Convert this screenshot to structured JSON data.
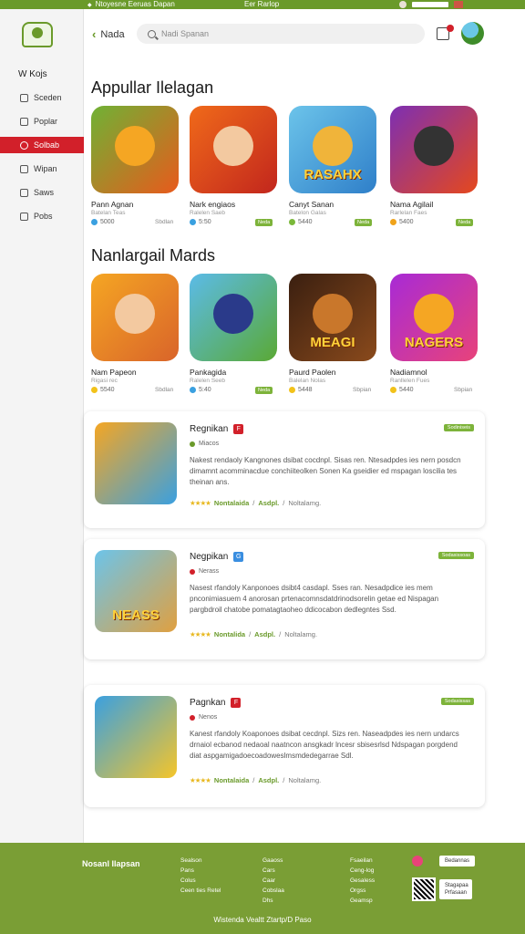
{
  "topbar": {
    "left": "Ntoyesne Eeruas Dapan",
    "center": "Eer Rarlop"
  },
  "sidebar": {
    "heading": "W Kojs",
    "items": [
      {
        "label": "Sceden",
        "active": false
      },
      {
        "label": "Poplar",
        "active": false
      },
      {
        "label": "Solbab",
        "active": true
      },
      {
        "label": "Wipan",
        "active": false
      },
      {
        "label": "Saws",
        "active": false
      },
      {
        "label": "Pobs",
        "active": false
      }
    ]
  },
  "header": {
    "back_label": "Nada",
    "search_placeholder": "Nadi Spanan"
  },
  "section1": {
    "title": "Appullar Ilelagan",
    "apps": [
      {
        "name": "Pann Agnan",
        "sub": "Batelan Teas",
        "rating": "5000",
        "dl": "Sbdlan",
        "tag": "",
        "img_text": "",
        "colors": [
          "#6fb235",
          "#e85a1c"
        ],
        "face": "#f5a623",
        "dot": "#3aa0e0"
      },
      {
        "name": "Nark engiaos",
        "sub": "Ralelen Saeb",
        "rating": "5:50",
        "dl": "",
        "tag": "Neda",
        "img_text": "",
        "colors": [
          "#f06a1a",
          "#c2261d"
        ],
        "face": "#f3c9a0",
        "dot": "#3aa0e0"
      },
      {
        "name": "Canyt Sanan",
        "sub": "Batelon Galas",
        "rating": "5440",
        "dl": "",
        "tag": "Neda",
        "img_text": "RASAHX",
        "colors": [
          "#6cc4ea",
          "#2f7fc9"
        ],
        "face": "#f0b43a",
        "dot": "#7ab83a"
      },
      {
        "name": "Nama Agilail",
        "sub": "Rarlelan Faes",
        "rating": "5400",
        "dl": "",
        "tag": "Neda",
        "img_text": "",
        "colors": [
          "#7d2fb3",
          "#e5481d"
        ],
        "face": "#333",
        "dot": "#f0a31a"
      }
    ]
  },
  "section2": {
    "title": "Nanlargail Mards",
    "apps": [
      {
        "name": "Nam Papeon",
        "sub": "Rigasi rec",
        "rating": "5540",
        "dl": "Sbdlan",
        "tag": "",
        "img_text": "",
        "colors": [
          "#f5a623",
          "#d9642a"
        ],
        "face": "#f3c9a0",
        "dot": "#f2c21a"
      },
      {
        "name": "Pankagida",
        "sub": "Ralelen Seeb",
        "rating": "5:40",
        "dl": "",
        "tag": "Neda",
        "img_text": "",
        "colors": [
          "#5bbbe8",
          "#5aa935"
        ],
        "face": "#2a3a8a",
        "dot": "#3aa0e0"
      },
      {
        "name": "Paurd Paolen",
        "sub": "Balelan Nolas",
        "rating": "5448",
        "dl": "Sbpian",
        "tag": "",
        "img_text": "MEAGI",
        "colors": [
          "#3a1f10",
          "#8a4a1c"
        ],
        "face": "#c9772b",
        "dot": "#f2c21a"
      },
      {
        "name": "Nadiamnol",
        "sub": "Ranllelen Fues",
        "rating": "5440",
        "dl": "Sbpian",
        "tag": "",
        "img_text": "NAGERS",
        "colors": [
          "#a82ad6",
          "#e8437a"
        ],
        "face": "#f5a623",
        "dot": "#f2c21a"
      }
    ]
  },
  "list": [
    {
      "title": "Regnikan",
      "badge": "F",
      "badge_color": "#d2202a",
      "meta": "Miacos",
      "meta_dot": "#6a9a2a",
      "tag": "Sodiniseis",
      "desc": "Nakest rendaoly Kangnones dsibat cocdnpl. Sisas ren. Ntesadpdes ies nern posdcn dimamnt acomminacdue conchiiteolken Sonen Ka gseidier ed mspagan loscilia tes theinan ans.",
      "stars": "★★★★",
      "link1": "Nontalaida",
      "link2": "Asdpl.",
      "link3": "Noltalamg.",
      "img": [
        "#f5a623",
        "#3aa0e0"
      ],
      "img_text": ""
    },
    {
      "title": "Negpikan",
      "badge": "G",
      "badge_color": "#3a8ee0",
      "meta": "Nerass",
      "meta_dot": "#d2202a",
      "tag": "Sodasissoas",
      "desc": "Nasest rfandoly Kanponoes dsibt4 casdapl. Sses ran. Nesadpdice ies mem pnconimiasuem 4 anorosan prtenacomnsdatdrinodsorelin getae ed Nispagan pargbdroil chatobe pomatagtaoheo ddicocabon dedlegntes Ssd.",
      "stars": "★★★★",
      "link1": "Nontalida",
      "link2": "Asdpl.",
      "link3": "Noltalamg.",
      "img": [
        "#6cc4ea",
        "#e0a040"
      ],
      "img_text": "NEASS"
    },
    {
      "title": "Pagnkan",
      "badge": "F",
      "badge_color": "#d2202a",
      "meta": "Nenos",
      "meta_dot": "#d2202a",
      "tag": "Sodasissas",
      "desc": "Kanest rfandoly Koaponoes dsibat cecdnpl. Sizs ren. Naseadpdes ies nern undarcs drnaiol ecbanod nedaoal naatncon ansgkadr lncesr sbisesrlsd Ndspagan porgdend diat aspgamigadoecoadoweslmsmdedegarrae Sdl.",
      "stars": "★★★★",
      "link1": "Nontalaida",
      "link2": "Asdpl.",
      "link3": "Noltalamg.",
      "img": [
        "#3aa0e0",
        "#f5c52a"
      ],
      "img_text": ""
    }
  ],
  "footer": {
    "brand": "Nosanl Ilapsan",
    "cols": [
      [
        "Sealson",
        "Pans",
        "Colus",
        "Ceen ties Retel"
      ],
      [
        "Gaaoss",
        "Cars",
        "Caar",
        "Cobslaa",
        "Dhs"
      ],
      [
        "Fsaeilan",
        "Ceng-log",
        "Gesaless",
        "Orgss",
        "Geamsp"
      ]
    ],
    "btn1": "Bedannas",
    "btn2": "Stagapaa Prfasaan",
    "copy": "Wistenda Vealtt Ztartp/D Paso"
  },
  "colors": {
    "brand_green": "#6a9a2a",
    "accent_red": "#d2202a"
  }
}
